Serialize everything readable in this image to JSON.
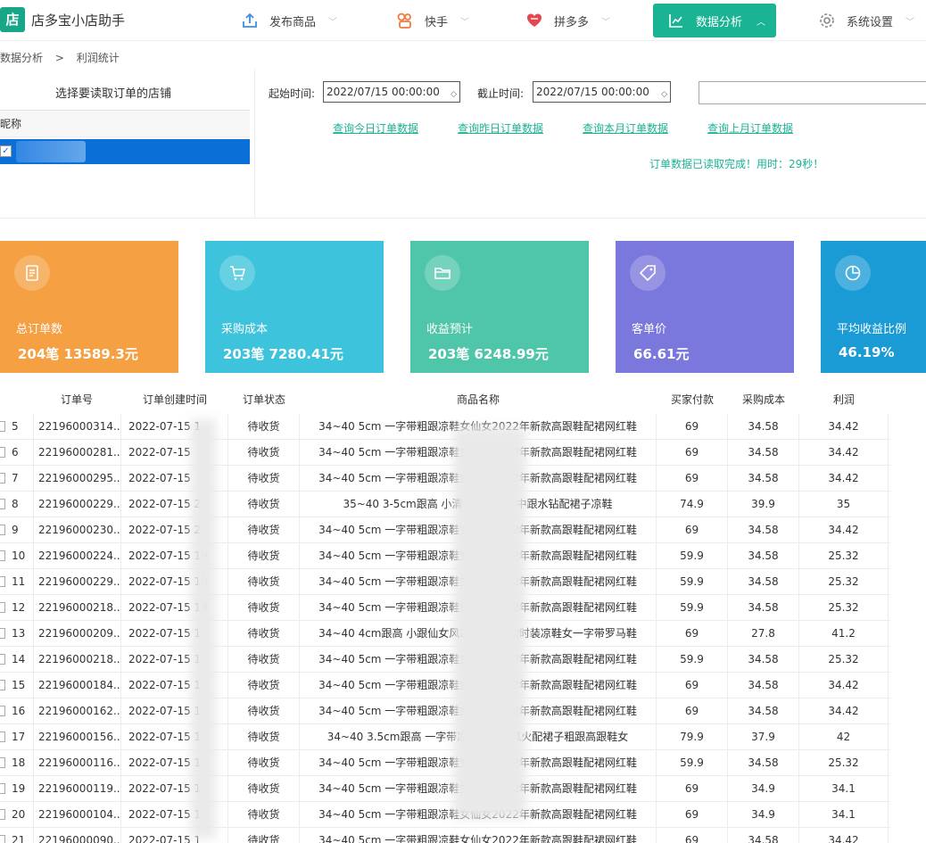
{
  "app": {
    "logo_char": "店",
    "title": "店多宝小店助手"
  },
  "nav": [
    {
      "label": "发布商品",
      "icon": "upload-icon"
    },
    {
      "label": "快手",
      "icon": "kuaishou-icon"
    },
    {
      "label": "拼多多",
      "icon": "pinduoduo-icon"
    },
    {
      "label": "数据分析",
      "icon": "chart-icon",
      "active": true
    },
    {
      "label": "系统设置",
      "icon": "gear-icon"
    }
  ],
  "breadcrumb": [
    "数据分析",
    ">",
    "利润统计"
  ],
  "shop_panel": {
    "title": "选择要读取订单的店铺",
    "column": "昵称",
    "check_mark": "✓"
  },
  "query": {
    "start_label": "起始时间:",
    "start_value": "2022/07/15 00:00:00",
    "end_label": "截止时间:",
    "end_value": "2022/07/15 00:00:00",
    "links": [
      "查询今日订单数据",
      "查询昨日订单数据",
      "查询本月订单数据",
      "查询上月订单数据"
    ],
    "status": "订单数据已读取完成！用时：29秒！"
  },
  "colors": {
    "accent": "#1ab394",
    "card_orange": "#f5a043",
    "card_cyan": "#3ec3dc",
    "card_teal": "#4fc6a9",
    "card_purple": "#7a78dc",
    "card_blue": "#1b9bd6"
  },
  "cards": [
    {
      "label": "总订单数",
      "value": "204笔 13589.3元",
      "icon": "document-icon"
    },
    {
      "label": "采购成本",
      "value": "203笔 7280.41元",
      "icon": "cart-icon"
    },
    {
      "label": "收益预计",
      "value": "203笔 6248.99元",
      "icon": "folder-icon"
    },
    {
      "label": "客单价",
      "value": "66.61元",
      "icon": "tag-icon"
    },
    {
      "label": "平均收益比例",
      "value": "46.19%",
      "icon": "pie-icon"
    }
  ],
  "table": {
    "headers": [
      "订单号",
      "订单创建时间",
      "订单状态",
      "商品名称",
      "买家付款",
      "采购成本",
      "利润"
    ],
    "rows": [
      [
        "5",
        "22196000314...",
        "2022-07-15 1",
        "待收货",
        "34~40 5cm 一字带粗跟凉鞋女仙女2022年新款高跟鞋配裙网红鞋",
        "69",
        "34.58",
        "34.42"
      ],
      [
        "6",
        "22196000281...",
        "2022-07-15",
        "待收货",
        "34~40 5cm 一字带粗跟凉鞋女仙女2022年新款高跟鞋配裙网红鞋",
        "69",
        "34.58",
        "34.42"
      ],
      [
        "7",
        "22196000295...",
        "2022-07-15",
        "待收货",
        "34~40 5cm 一字带粗跟凉鞋女仙女2022年新款高跟鞋配裙网红鞋",
        "69",
        "34.58",
        "34.42"
      ],
      [
        "8",
        "22196000229...",
        "2022-07-15 2",
        "待收货",
        "35~40 3-5cm跟高 小清新粗跟夏季中跟水钻配裙子凉鞋",
        "74.9",
        "39.9",
        "35"
      ],
      [
        "9",
        "22196000230...",
        "2022-07-15 2",
        "待收货",
        "34~40 5cm 一字带粗跟凉鞋女仙女2022年新款高跟鞋配裙网红鞋",
        "69",
        "34.58",
        "34.42"
      ],
      [
        "10",
        "22196000224...",
        "2022-07-15 19",
        "待收货",
        "34~40 5cm 一字带粗跟凉鞋女仙女2022年新款高跟鞋配裙网红鞋",
        "59.9",
        "34.58",
        "25.32"
      ],
      [
        "11",
        "22196000229...",
        "2022-07-15 19",
        "待收货",
        "34~40 5cm 一字带粗跟凉鞋女仙女2022年新款高跟鞋配裙网红鞋",
        "59.9",
        "34.58",
        "25.32"
      ],
      [
        "12",
        "22196000218...",
        "2022-07-15 19",
        "待收货",
        "34~40 5cm 一字带粗跟凉鞋女仙女2022年新款高跟鞋配裙网红鞋",
        "59.9",
        "34.58",
        "25.32"
      ],
      [
        "13",
        "22196000209...",
        "2022-07-15 1",
        "待收货",
        "34~40 4cm跟高 小跟仙女风2022年新款时装凉鞋女一字带罗马鞋",
        "69",
        "27.8",
        "41.2"
      ],
      [
        "14",
        "22196000218...",
        "2022-07-15 1",
        "待收货",
        "34~40 5cm 一字带粗跟凉鞋女仙女2022年新款高跟鞋配裙网红鞋",
        "59.9",
        "34.58",
        "25.32"
      ],
      [
        "15",
        "22196000184...",
        "2022-07-15 1",
        "待收货",
        "34~40 5cm 一字带粗跟凉鞋女仙女2022年新款高跟鞋配裙网红鞋",
        "69",
        "34.58",
        "34.42"
      ],
      [
        "16",
        "22196000162...",
        "2022-07-15 1",
        "待收货",
        "34~40 5cm 一字带粗跟凉鞋女仙女2022年新款高跟鞋配裙网红鞋",
        "69",
        "34.58",
        "34.42"
      ],
      [
        "17",
        "22196000156...",
        "2022-07-15 1",
        "待收货",
        "34~40 3.5cm跟高 一字带凉鞋女仙女风火配裙子粗跟高跟鞋女",
        "79.9",
        "37.9",
        "42"
      ],
      [
        "18",
        "22196000116...",
        "2022-07-15 1",
        "待收货",
        "34~40 5cm 一字带粗跟凉鞋女仙女2022年新款高跟鞋配裙网红鞋",
        "59.9",
        "34.58",
        "25.32"
      ],
      [
        "19",
        "22196000119...",
        "2022-07-15 1",
        "待收货",
        "34~40 5cm 一字带粗跟凉鞋女仙女2022年新款高跟鞋配裙网红鞋",
        "69",
        "34.9",
        "34.1"
      ],
      [
        "20",
        "22196000104...",
        "2022-07-15 1",
        "待收货",
        "34~40 5cm 一字带粗跟凉鞋女仙女2022年新款高跟鞋配裙网红鞋",
        "69",
        "34.9",
        "34.1"
      ],
      [
        "21",
        "22196000090...",
        "2022-07-15 1",
        "待收货",
        "34~40 5cm 一字带粗跟凉鞋女仙女2022年新款高跟鞋配裙网红鞋",
        "69",
        "34.58",
        "34.42"
      ]
    ]
  }
}
